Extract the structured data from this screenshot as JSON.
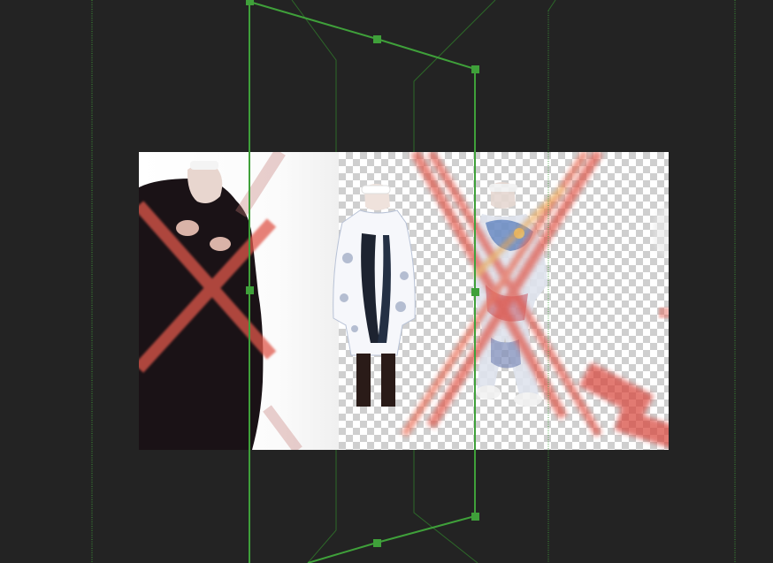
{
  "viewer": {
    "background_color": "#232323",
    "guide_color": "#3fa03a",
    "handle_color": "#3fa03a",
    "cross_color": "#e0584c"
  },
  "layer": {
    "figures": [
      "figure-left-dark-coat",
      "figure-center-patterned-coat",
      "figure-right-painted-outfit"
    ],
    "transparency": "checkerboard"
  }
}
